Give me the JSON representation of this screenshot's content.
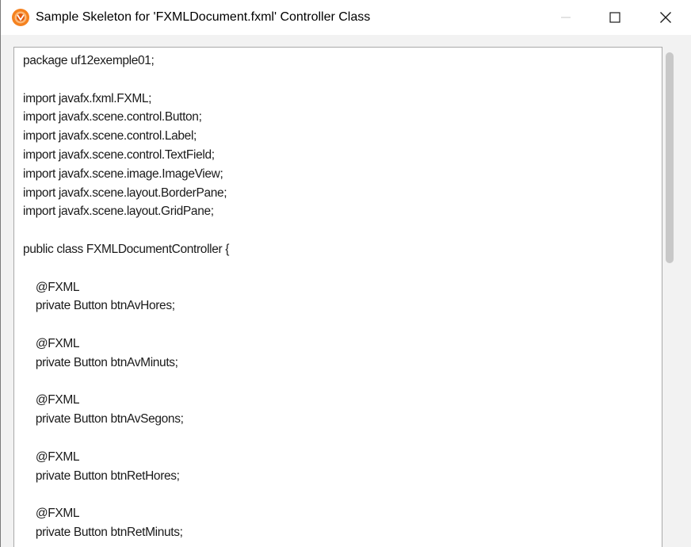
{
  "window": {
    "title": "Sample Skeleton for 'FXMLDocument.fxml' Controller Class",
    "icon": "netbeans-app-icon",
    "controls": {
      "minimize_icon": "minimize-icon",
      "maximize_icon": "maximize-icon",
      "close_icon": "close-icon"
    }
  },
  "code_lines": [
    "package uf12exemple01;",
    "",
    "import javafx.fxml.FXML;",
    "import javafx.scene.control.Button;",
    "import javafx.scene.control.Label;",
    "import javafx.scene.control.TextField;",
    "import javafx.scene.image.ImageView;",
    "import javafx.scene.layout.BorderPane;",
    "import javafx.scene.layout.GridPane;",
    "",
    "public class FXMLDocumentController {",
    "",
    "    @FXML",
    "    private Button btnAvHores;",
    "",
    "    @FXML",
    "    private Button btnAvMinuts;",
    "",
    "    @FXML",
    "    private Button btnAvSegons;",
    "",
    "    @FXML",
    "    private Button btnRetHores;",
    "",
    "    @FXML",
    "    private Button btnRetMinuts;",
    ""
  ],
  "scrollbar": {
    "visible_fraction": 0.42,
    "position_fraction": 0.0
  },
  "colors": {
    "icon_accent": "#f5821f",
    "window_bg": "#f2f2f2",
    "content_bg": "#ffffff",
    "text": "#1a1a1a"
  }
}
